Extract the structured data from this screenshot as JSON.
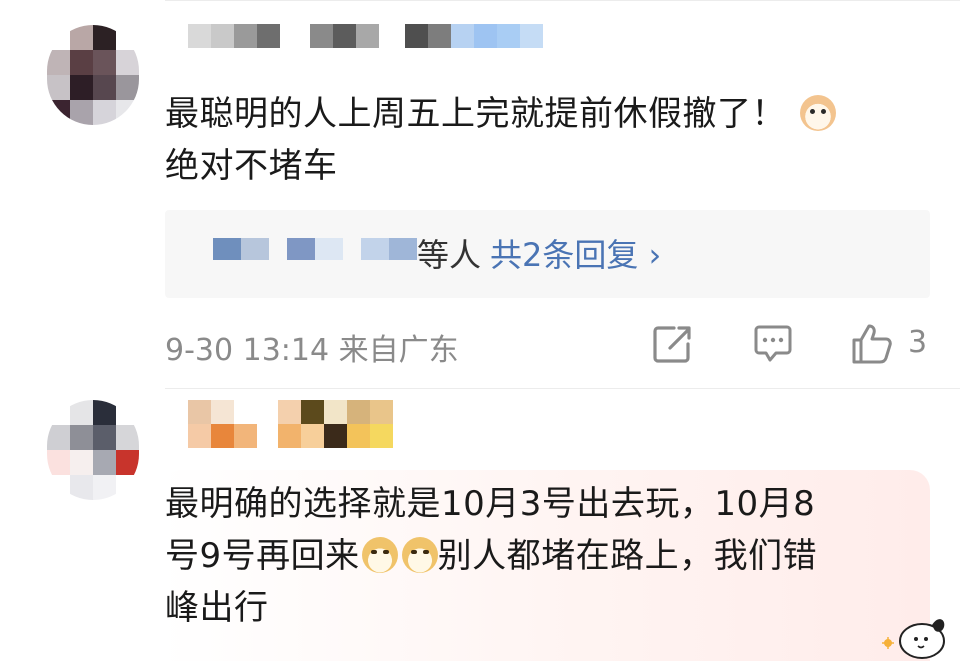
{
  "comments": [
    {
      "text_line1": "最聪明的人上周五上完就提前休假撤了！",
      "text_line2": "绝对不堵车",
      "emoji": "cat-face-emoji",
      "reply_suffix": "等人",
      "reply_link": "共2条回复",
      "reply_chevron": "›",
      "time_location": "9-30 13:14 来自广东",
      "like_count": "3"
    },
    {
      "text_line1": "最明确的选择就是10月3号出去玩，10月8",
      "text_line2_a": "号9号再回来",
      "text_line2_b": "别人都堵在路上，我们错",
      "text_line3": "峰出行",
      "emoji": "doge-emoji"
    }
  ],
  "icons": [
    "share-icon",
    "comment-icon",
    "like-icon"
  ],
  "colors": {
    "link": "#4a74b4",
    "meta": "#8a8a8a",
    "text": "#1a1a1a"
  }
}
